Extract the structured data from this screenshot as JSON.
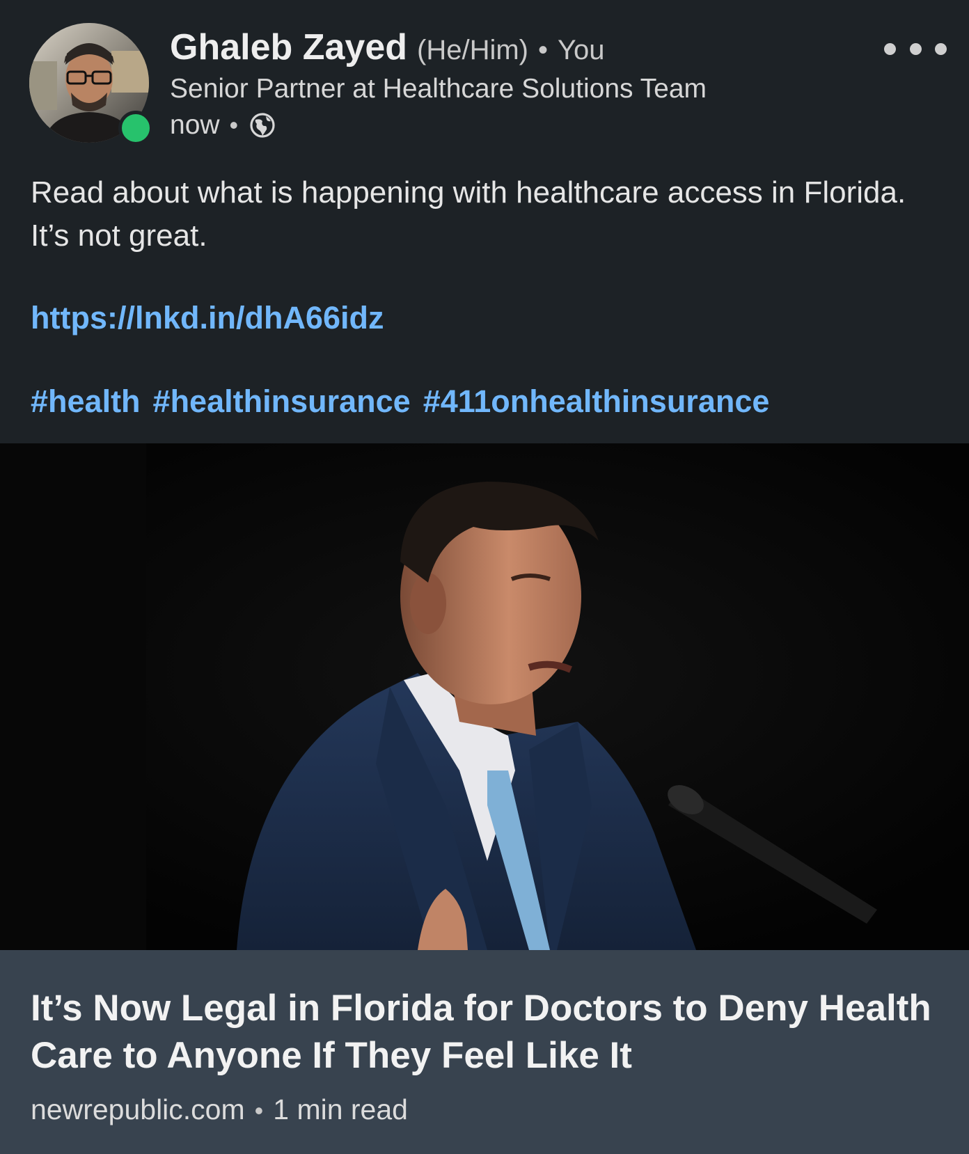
{
  "author": {
    "name": "Ghaleb Zayed",
    "pronouns": "(He/Him)",
    "relation": "You",
    "headline": "Senior Partner at Healthcare Solutions Team",
    "timestamp": "now",
    "separator": "•",
    "visibility_icon": "globe-icon",
    "online_status_color": "#27c26c"
  },
  "post": {
    "text": "Read about what is happening with healthcare access in Florida. It’s not great.",
    "link": "https://lnkd.in/dhA66idz",
    "hashtags": [
      "#health",
      "#healthinsurance",
      "#411onhealthinsurance"
    ]
  },
  "article": {
    "title": "It’s Now Legal in Florida for Doctors to Deny Health Care to Anyone If They Feel Like It",
    "source": "newrepublic.com",
    "read_time": "1 min read"
  },
  "colors": {
    "background": "#1d2226",
    "link": "#71b7fb",
    "article_info_bg": "#38434f"
  }
}
